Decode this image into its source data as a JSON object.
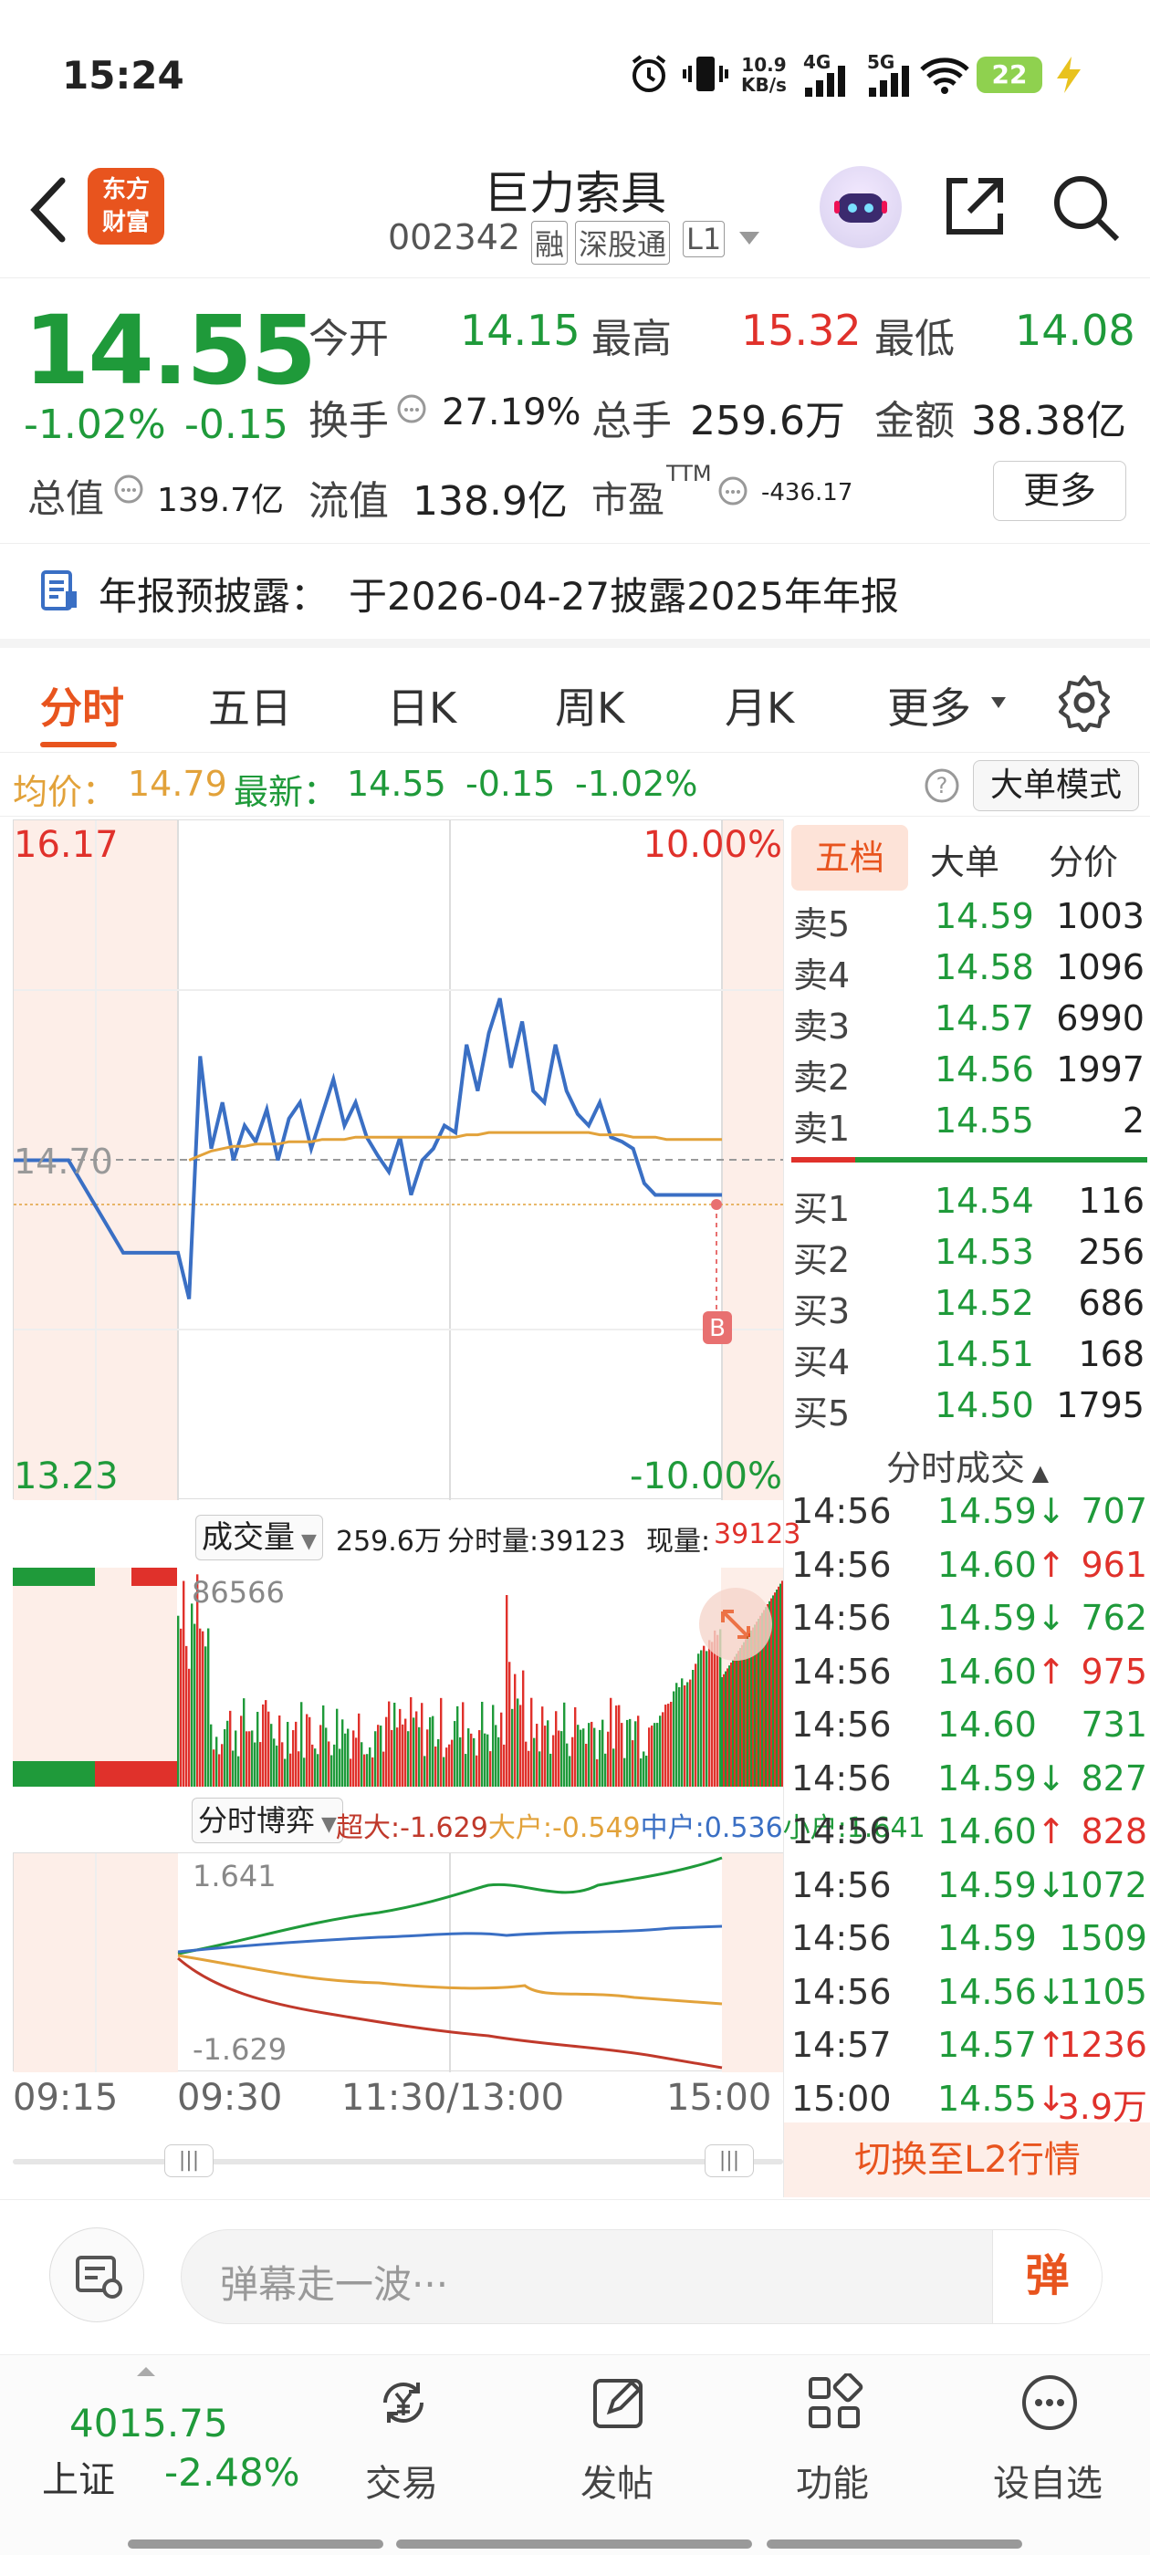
{
  "status": {
    "time": "15:24",
    "net_speed": "10.9",
    "net_unit": "KB/s",
    "sig1": "4G",
    "sig2": "5G",
    "battery": "22"
  },
  "header": {
    "logo_line1": "东方",
    "logo_line2": "财富",
    "title": "巨力索具",
    "code": "002342",
    "tag1": "融",
    "tag2": "深股通",
    "tag3": "L1"
  },
  "quote": {
    "price": "14.55",
    "pct": "-1.02%",
    "chg": "-0.15",
    "open_label": "今开",
    "open": "14.15",
    "high_label": "最高",
    "high": "15.32",
    "low_label": "最低",
    "low": "14.08",
    "turnover_label": "换手",
    "turnover": "27.19%",
    "vol_label": "总手",
    "vol": "259.6万",
    "amount_label": "金额",
    "amount": "38.38亿",
    "mcap_label": "总值",
    "mcap": "139.7亿",
    "float_label": "流值",
    "float": "138.9亿",
    "pe_label": "市盈",
    "pe_sup": "TTM",
    "pe": "-436.17",
    "more": "更多"
  },
  "notice": {
    "label": "年报预披露：",
    "text": "于2026-04-27披露2025年年报"
  },
  "tabs": [
    "分时",
    "五日",
    "日K",
    "周K",
    "月K",
    "更多"
  ],
  "info": {
    "avg_label": "均价：",
    "avg": "14.79",
    "last_label": "最新：",
    "last": "14.55",
    "chg": "-0.15",
    "pct": "-1.02%",
    "mode_btn": "大单模式"
  },
  "chart_labels": {
    "y_top": "16.17",
    "y_mid": "14.70",
    "y_bot": "13.23",
    "pct_top": "10.00%",
    "pct_bot": "-10.00%",
    "b_marker": "B"
  },
  "volume": {
    "selector": "成交量",
    "total": "259.6万",
    "fs_label": "分时量:39123",
    "xl_label": "现量:",
    "xl": "39123",
    "max": "86566"
  },
  "flow": {
    "selector": "分时博弈",
    "s1_label": "超大:",
    "s1": "-1.629",
    "s2_label": "大户:",
    "s2": "-0.549",
    "s3_label": "中户:",
    "s3": "0.536",
    "s4_label": "小户:",
    "s4": "1.641",
    "top": "1.641",
    "bot": "-1.629"
  },
  "time_axis": [
    "09:15",
    "09:30",
    "11:30/13:00",
    "15:00"
  ],
  "panel": {
    "tab1": "五档",
    "tab2": "大单",
    "tab3": "分价",
    "trades_title": "分时成交",
    "l2_btn": "切换至L2行情"
  },
  "asks": [
    {
      "label": "卖5",
      "price": "14.59",
      "vol": "1003"
    },
    {
      "label": "卖4",
      "price": "14.58",
      "vol": "1096"
    },
    {
      "label": "卖3",
      "price": "14.57",
      "vol": "6990"
    },
    {
      "label": "卖2",
      "price": "14.56",
      "vol": "1997"
    },
    {
      "label": "卖1",
      "price": "14.55",
      "vol": "2"
    }
  ],
  "bids": [
    {
      "label": "买1",
      "price": "14.54",
      "vol": "116"
    },
    {
      "label": "买2",
      "price": "14.53",
      "vol": "256"
    },
    {
      "label": "买3",
      "price": "14.52",
      "vol": "686"
    },
    {
      "label": "买4",
      "price": "14.51",
      "vol": "168"
    },
    {
      "label": "买5",
      "price": "14.50",
      "vol": "1795"
    }
  ],
  "trades": [
    {
      "t": "14:56",
      "p": "14.59",
      "d": "↓",
      "v": "707",
      "c": "green"
    },
    {
      "t": "14:56",
      "p": "14.60",
      "d": "↑",
      "v": "961",
      "c": "red"
    },
    {
      "t": "14:56",
      "p": "14.59",
      "d": "↓",
      "v": "762",
      "c": "green"
    },
    {
      "t": "14:56",
      "p": "14.60",
      "d": "↑",
      "v": "975",
      "c": "red"
    },
    {
      "t": "14:56",
      "p": "14.60",
      "d": "",
      "v": "731",
      "c": "green"
    },
    {
      "t": "14:56",
      "p": "14.59",
      "d": "↓",
      "v": "827",
      "c": "green"
    },
    {
      "t": "14:56",
      "p": "14.60",
      "d": "↑",
      "v": "828",
      "c": "red"
    },
    {
      "t": "14:56",
      "p": "14.59",
      "d": "↓",
      "v": "1072",
      "c": "green"
    },
    {
      "t": "14:56",
      "p": "14.59",
      "d": "",
      "v": "1509",
      "c": "green"
    },
    {
      "t": "14:56",
      "p": "14.56",
      "d": "↓",
      "v": "1105",
      "c": "green"
    },
    {
      "t": "14:57",
      "p": "14.57",
      "d": "↑",
      "v": "1236",
      "c": "red"
    },
    {
      "t": "15:00",
      "p": "14.55",
      "d": "↓",
      "v": "3.9万",
      "c": "red"
    }
  ],
  "comment": {
    "placeholder": "弹幕走一波···",
    "btn": "弹"
  },
  "bottom": {
    "index_val": "4015.75",
    "index_name": "上证",
    "index_pct": "-2.48%",
    "nav": [
      "交易",
      "发帖",
      "功能",
      "设自选"
    ]
  },
  "colors": {
    "up": "#e0312b",
    "down": "#1f9a3a",
    "accent": "#e8541e",
    "line": "#3a6fc4",
    "avg": "#e2a23a"
  },
  "chart_data": {
    "type": "line",
    "title": "",
    "ylim": [
      13.23,
      16.17
    ],
    "prev_close": 14.7,
    "xlabel": "",
    "ylabel": "",
    "x": [
      "09:15",
      "09:20",
      "09:25",
      "09:30",
      "09:35",
      "09:40",
      "09:45",
      "09:50",
      "09:55",
      "10:00",
      "10:05",
      "10:10",
      "10:15",
      "10:20",
      "10:25",
      "10:30",
      "10:35",
      "10:40",
      "10:45",
      "10:50",
      "10:55",
      "11:00",
      "11:05",
      "11:10",
      "11:15",
      "11:20",
      "11:25",
      "11:30",
      "13:00",
      "13:05",
      "13:10",
      "13:15",
      "13:20",
      "13:25",
      "13:30",
      "13:35",
      "13:40",
      "13:45",
      "13:50",
      "13:55",
      "14:00",
      "14:05",
      "14:10",
      "14:15",
      "14:20",
      "14:25",
      "14:30",
      "14:35",
      "14:40",
      "14:45",
      "14:50",
      "14:55",
      "15:00"
    ],
    "series": [
      {
        "values": [
          14.7,
          14.7,
          14.3,
          14.3,
          14.1,
          15.15,
          14.75,
          14.95,
          14.7,
          14.85,
          14.78,
          14.92,
          14.7,
          14.88,
          14.95,
          14.75,
          14.9,
          15.05,
          14.85,
          14.95,
          14.8,
          14.72,
          14.65,
          14.8,
          14.55,
          14.7,
          14.75,
          14.85,
          14.82,
          15.2,
          15.0,
          15.25,
          15.4,
          15.1,
          15.3,
          15.0,
          14.95,
          15.2,
          15.0,
          14.9,
          14.85,
          14.95,
          14.8,
          14.78,
          14.75,
          14.6,
          14.55,
          14.55,
          14.55,
          14.55,
          14.55,
          14.55,
          14.55
        ]
      },
      {
        "values": [
          null,
          null,
          null,
          null,
          14.7,
          14.72,
          14.74,
          14.75,
          14.76,
          14.76,
          14.77,
          14.77,
          14.77,
          14.78,
          14.78,
          14.78,
          14.79,
          14.79,
          14.79,
          14.8,
          14.8,
          14.8,
          14.8,
          14.8,
          14.8,
          14.8,
          14.8,
          14.8,
          14.8,
          14.81,
          14.81,
          14.82,
          14.82,
          14.82,
          14.82,
          14.82,
          14.82,
          14.82,
          14.82,
          14.82,
          14.82,
          14.81,
          14.81,
          14.81,
          14.8,
          14.8,
          14.8,
          14.79,
          14.79,
          14.79,
          14.79,
          14.79,
          14.79
        ]
      }
    ]
  }
}
